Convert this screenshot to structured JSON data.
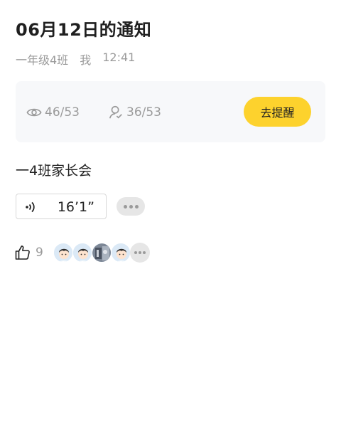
{
  "notice": {
    "title": "06月12日的通知",
    "class_name": "一年级4班",
    "sender": "我",
    "time": "12:41",
    "content": "一4班家长会"
  },
  "stats": {
    "viewed": "46/53",
    "confirmed": "36/53",
    "remind_label": "去提醒"
  },
  "voice": {
    "duration": "16’1”"
  },
  "likes": {
    "count": "9",
    "avatar_icons": [
      "boy-avatar-icon",
      "boy-avatar-icon",
      "photo-avatar-icon",
      "boy-avatar-icon"
    ]
  },
  "colors": {
    "accent": "#fdd22d",
    "muted_text": "#9a9a9a",
    "card_bg": "#f7f8fa"
  }
}
